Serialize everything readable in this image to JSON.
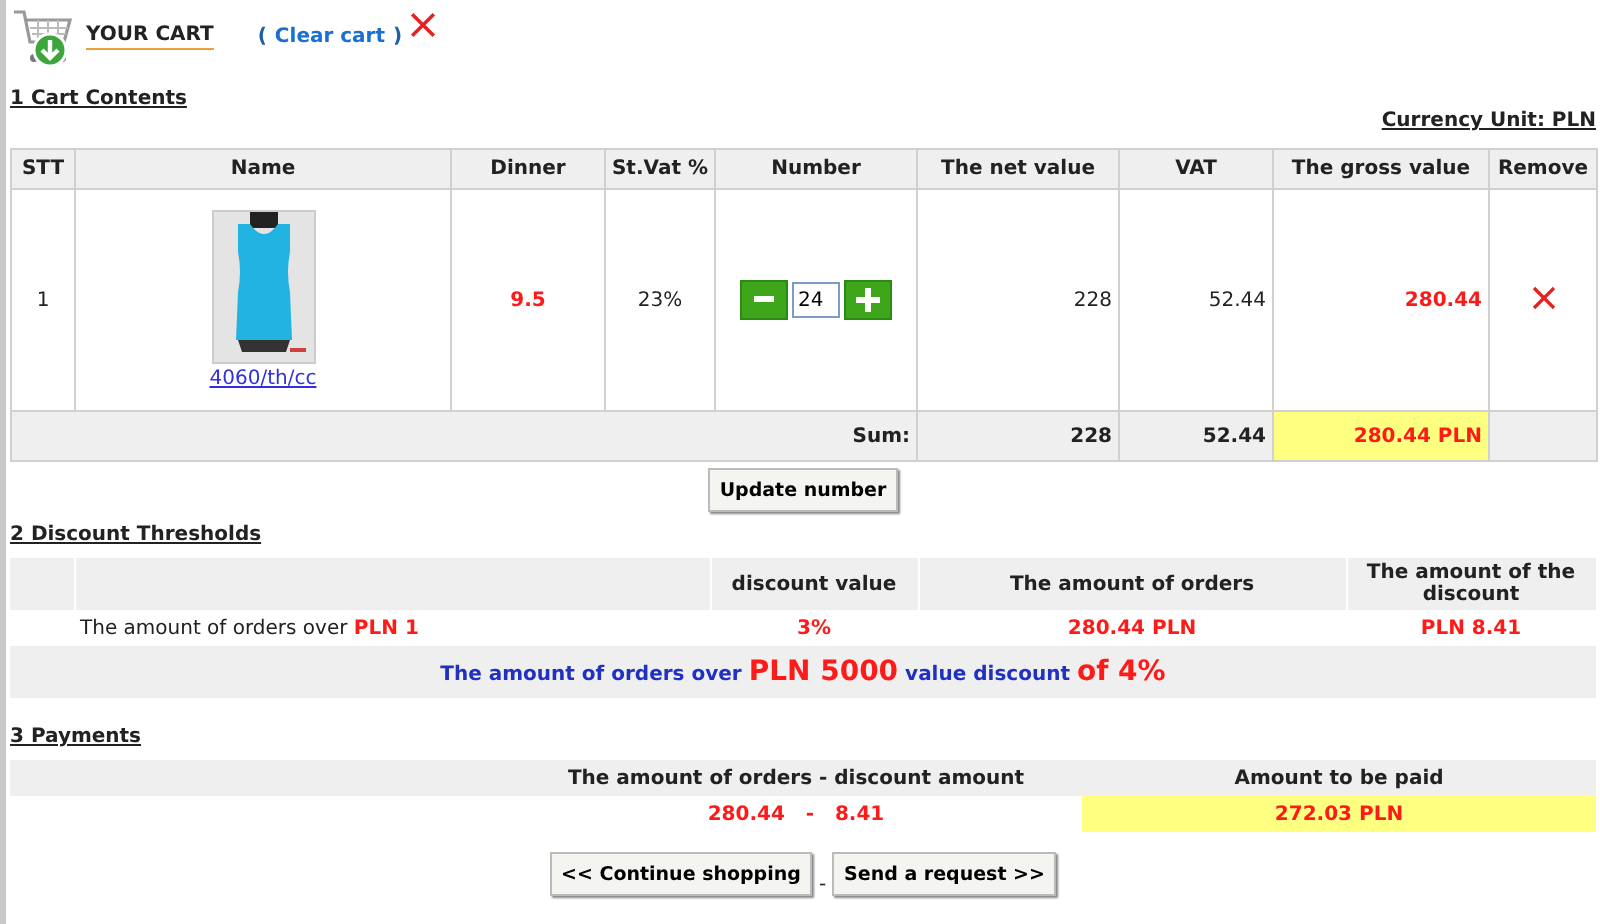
{
  "header": {
    "title": "YOUR CART",
    "clear_open": "(",
    "clear_link": "Clear cart",
    "clear_close": ")"
  },
  "cart": {
    "heading": "1 Cart Contents",
    "currency": "Currency Unit: PLN",
    "columns": [
      "STT",
      "Name",
      "Dinner",
      "St.Vat %",
      "Number",
      "The net value",
      "VAT",
      "The gross value",
      "Remove"
    ],
    "rows": [
      {
        "stt": "1",
        "name": "4060/th/cc",
        "price": "9.5",
        "vat_rate": "23%",
        "quantity": "24",
        "net": "228",
        "vat": "52.44",
        "gross": "280.44"
      }
    ],
    "sum": {
      "label": "Sum:",
      "net": "228",
      "vat": "52.44",
      "gross": "280.44 PLN"
    },
    "update_button": "Update number"
  },
  "discounts": {
    "heading": "2 Discount Thresholds",
    "columns": [
      "discount value",
      "The amount of orders",
      "The amount of the discount"
    ],
    "rows": [
      {
        "label": [
          {
            "text": "The amount of orders over ",
            "emphasis": false
          },
          {
            "text": "PLN 1",
            "emphasis": true
          }
        ],
        "discount_value": "3%",
        "order_amount": "280.44 PLN",
        "discount_amount": "PLN 8.41"
      }
    ],
    "note": [
      {
        "text": "The amount of orders over ",
        "emphasis": false
      },
      {
        "text": "PLN 5000",
        "emphasis": true
      },
      {
        "text": " value discount ",
        "emphasis": false
      },
      {
        "text": "of 4%",
        "emphasis": true
      }
    ]
  },
  "payments": {
    "heading": "3 Payments",
    "columns": [
      "The amount of orders - discount amount",
      "Amount to be paid"
    ],
    "calculation": "280.44   -   8.41",
    "total": "272.03 PLN"
  },
  "buttons": {
    "back": "<< Continue shopping",
    "separator": "-",
    "send": "Send a request >>"
  }
}
